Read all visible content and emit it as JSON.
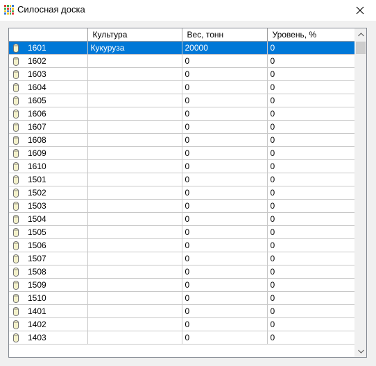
{
  "window": {
    "title": "Силосная доска"
  },
  "grid": {
    "columns": [
      "",
      "Культура",
      "Вес, тонн",
      "Уровень, %"
    ],
    "selected_row_index": 0,
    "rows": [
      {
        "id": "1601",
        "crop": "Кукуруза",
        "weight": "20000",
        "level": "0"
      },
      {
        "id": "1602",
        "crop": "",
        "weight": "0",
        "level": "0"
      },
      {
        "id": "1603",
        "crop": "",
        "weight": "0",
        "level": "0"
      },
      {
        "id": "1604",
        "crop": "",
        "weight": "0",
        "level": "0"
      },
      {
        "id": "1605",
        "crop": "",
        "weight": "0",
        "level": "0"
      },
      {
        "id": "1606",
        "crop": "",
        "weight": "0",
        "level": "0"
      },
      {
        "id": "1607",
        "crop": "",
        "weight": "0",
        "level": "0"
      },
      {
        "id": "1608",
        "crop": "",
        "weight": "0",
        "level": "0"
      },
      {
        "id": "1609",
        "crop": "",
        "weight": "0",
        "level": "0"
      },
      {
        "id": "1610",
        "crop": "",
        "weight": "0",
        "level": "0"
      },
      {
        "id": "1501",
        "crop": "",
        "weight": "0",
        "level": "0"
      },
      {
        "id": "1502",
        "crop": "",
        "weight": "0",
        "level": "0"
      },
      {
        "id": "1503",
        "crop": "",
        "weight": "0",
        "level": "0"
      },
      {
        "id": "1504",
        "crop": "",
        "weight": "0",
        "level": "0"
      },
      {
        "id": "1505",
        "crop": "",
        "weight": "0",
        "level": "0"
      },
      {
        "id": "1506",
        "crop": "",
        "weight": "0",
        "level": "0"
      },
      {
        "id": "1507",
        "crop": "",
        "weight": "0",
        "level": "0"
      },
      {
        "id": "1508",
        "crop": "",
        "weight": "0",
        "level": "0"
      },
      {
        "id": "1509",
        "crop": "",
        "weight": "0",
        "level": "0"
      },
      {
        "id": "1510",
        "crop": "",
        "weight": "0",
        "level": "0"
      },
      {
        "id": "1401",
        "crop": "",
        "weight": "0",
        "level": "0"
      },
      {
        "id": "1402",
        "crop": "",
        "weight": "0",
        "level": "0"
      },
      {
        "id": "1403",
        "crop": "",
        "weight": "0",
        "level": "0"
      }
    ]
  },
  "icons": {
    "app": "grid-app-icon",
    "row": "silo-icon",
    "close": "close-icon",
    "scroll_up": "chevron-up-icon",
    "scroll_down": "chevron-down-icon"
  },
  "colors": {
    "selection": "#0078d7",
    "silo_body": "#f3f1c9",
    "silo_outline": "#6f6f6f"
  }
}
